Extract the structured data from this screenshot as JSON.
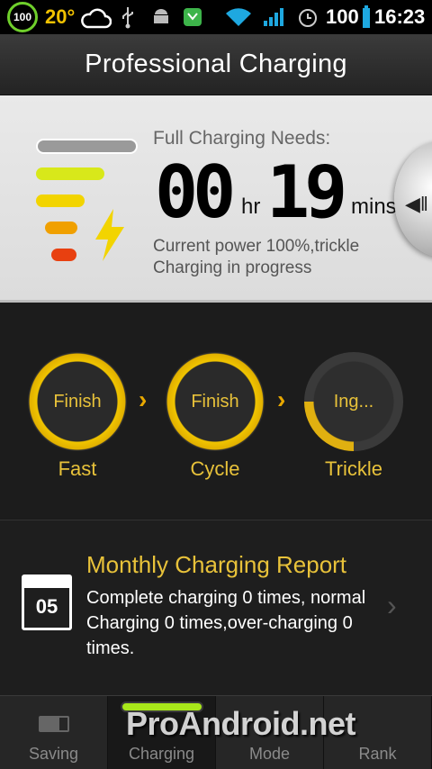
{
  "status_bar": {
    "battery_badge": "100",
    "temperature": "20°",
    "battery_percent": "100",
    "time": "16:23",
    "icons": [
      "weather-cloud-icon",
      "usb-icon",
      "android-icon",
      "app-icon",
      "wifi-icon",
      "signal-icon",
      "alarm-icon",
      "battery-icon"
    ]
  },
  "header": {
    "title": "Professional Charging"
  },
  "charge_info": {
    "label": "Full Charging Needs:",
    "hours": "00",
    "hours_unit": "hr",
    "minutes": "19",
    "minutes_unit": "mins",
    "status_line1": "Current power 100%,trickle",
    "status_line2": "Charging in progress",
    "level_colors": [
      "#9a9a9a",
      "#d8e81a",
      "#f2d400",
      "#f0a000",
      "#e84010"
    ]
  },
  "stages": [
    {
      "status": "Finish",
      "name": "Fast"
    },
    {
      "status": "Finish",
      "name": "Cycle"
    },
    {
      "status": "Ing...",
      "name": "Trickle",
      "progress": 0.25
    }
  ],
  "report": {
    "day": "05",
    "title": "Monthly Charging Report",
    "text": "Complete charging 0 times, normal Charging 0 times,over-charging 0 times."
  },
  "nav": {
    "tabs": [
      {
        "label": "Saving"
      },
      {
        "label": "Charging"
      },
      {
        "label": "Mode"
      },
      {
        "label": "Rank"
      }
    ],
    "active": "Charging"
  },
  "watermark": "ProAndroid.net",
  "colors": {
    "accent": "#e8c23a",
    "ring": "#f0c400",
    "indicator": "#a8e81a"
  }
}
